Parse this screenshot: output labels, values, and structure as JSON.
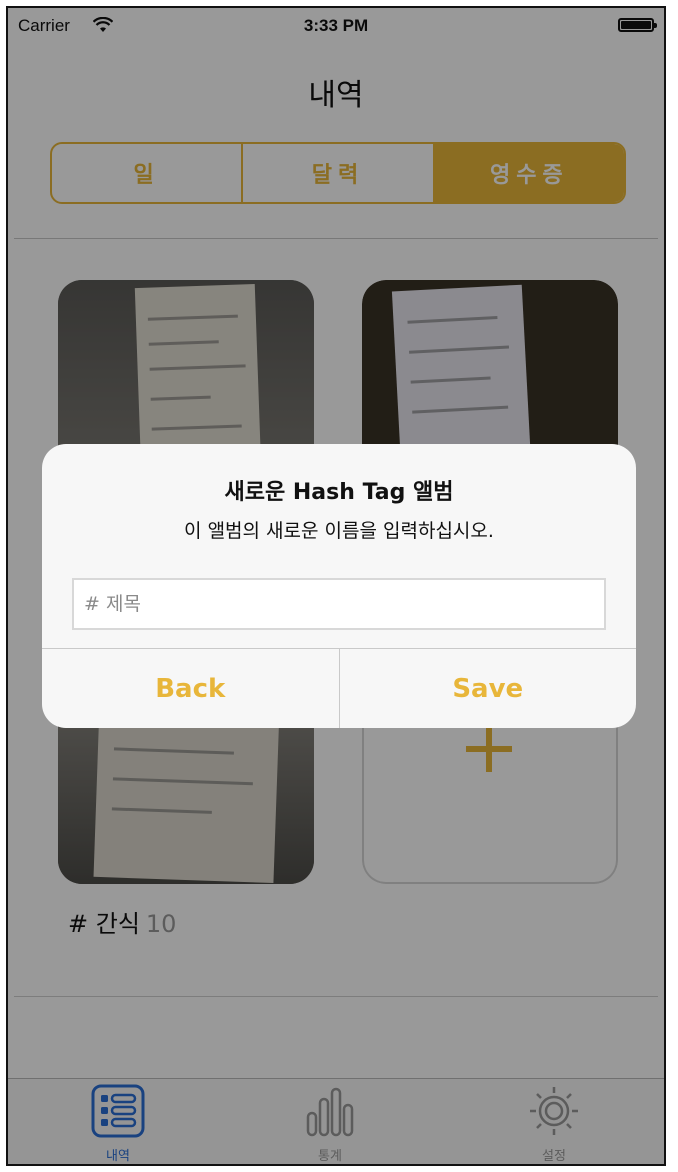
{
  "status": {
    "carrier": "Carrier",
    "time": "3:33 PM"
  },
  "nav": {
    "title": "내역"
  },
  "segments": [
    {
      "label": "일",
      "active": false
    },
    {
      "label": "달력",
      "active": false
    },
    {
      "label": "영수증",
      "active": true
    }
  ],
  "albums": [
    {
      "tag": "# 간식",
      "count": "10"
    }
  ],
  "tabbar": [
    {
      "label": "내역",
      "icon": "list-icon",
      "selected": true
    },
    {
      "label": "통계",
      "icon": "bar-chart-icon",
      "selected": false
    },
    {
      "label": "설정",
      "icon": "gear-icon",
      "selected": false
    }
  ],
  "alert": {
    "title": "새로운 Hash Tag 앨범",
    "message": "이 앨범의 새로운 이름을 입력하십시오.",
    "input_placeholder": "# 제목",
    "input_value": "",
    "back_label": "Back",
    "save_label": "Save"
  },
  "colors": {
    "accent": "#e8b63a",
    "tab_selected": "#2b6fd6"
  }
}
